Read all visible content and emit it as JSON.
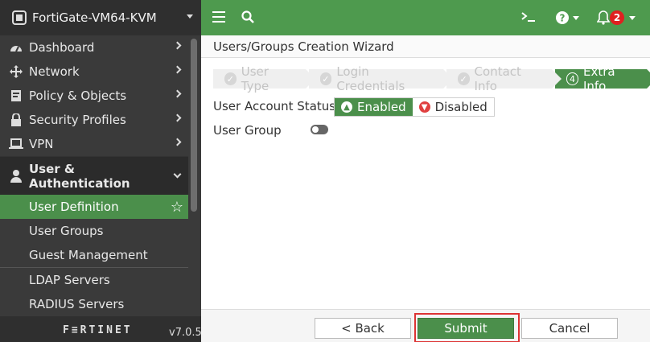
{
  "sidebar": {
    "device_name": "FortiGate-VM64-KVM",
    "items": [
      {
        "label": "Dashboard",
        "icon": "dashboard-icon"
      },
      {
        "label": "Network",
        "icon": "network-icon"
      },
      {
        "label": "Policy & Objects",
        "icon": "policy-icon"
      },
      {
        "label": "Security Profiles",
        "icon": "lock-icon"
      },
      {
        "label": "VPN",
        "icon": "laptop-icon"
      }
    ],
    "section": {
      "label": "User & Authentication",
      "icon": "user-icon"
    },
    "sub_items": [
      {
        "label": "User Definition",
        "active": true
      },
      {
        "label": "User Groups"
      },
      {
        "label": "Guest Management"
      },
      {
        "label": "LDAP Servers"
      },
      {
        "label": "RADIUS Servers"
      }
    ],
    "logo_text": "F≡RTINET",
    "version": "v7.0.5"
  },
  "topbar": {
    "badge_count": "2",
    "accent": "#4e9a4e"
  },
  "content": {
    "title": "Users/Groups Creation Wizard",
    "steps": [
      {
        "label": "User Type",
        "done": true
      },
      {
        "label": "Login Credentials",
        "done": true
      },
      {
        "label": "Contact Info",
        "done": true
      },
      {
        "label": "Extra Info",
        "number": "4",
        "active": true
      }
    ],
    "account_status_label": "User Account Status",
    "enabled_label": "Enabled",
    "disabled_label": "Disabled",
    "user_group_label": "User Group",
    "user_group_toggle": "off"
  },
  "buttons": {
    "back": "< Back",
    "submit": "Submit",
    "cancel": "Cancel"
  }
}
